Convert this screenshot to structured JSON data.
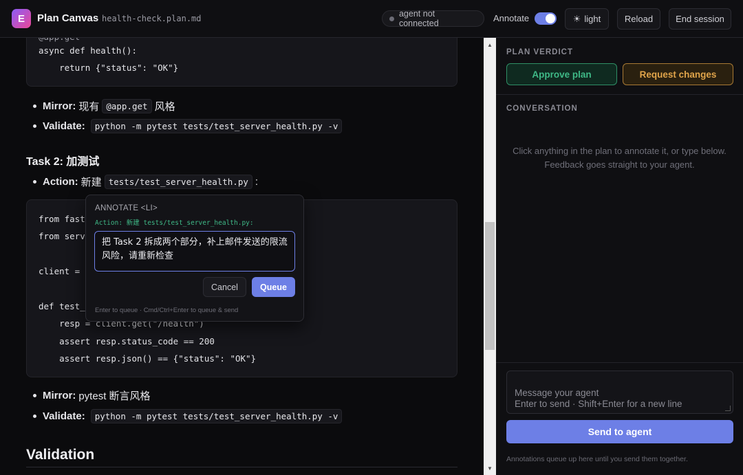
{
  "header": {
    "logo_letter": "E",
    "app_title": "Plan Canvas",
    "file_name": "health-check.plan.md",
    "agent_status": "agent not connected",
    "annotate_label": "Annotate",
    "annotate_enabled": true,
    "theme_label": "light",
    "reload_label": "Reload",
    "end_session_label": "End session"
  },
  "content": {
    "code_top": [
      "async def health():",
      "    return {\"status\": \"OK\"}"
    ],
    "task1_mirror_label": "Mirror:",
    "task1_mirror_text_pre": "现有",
    "task1_mirror_code": "@app.get",
    "task1_mirror_text_post": "风格",
    "task1_validate_label": "Validate:",
    "task1_validate_code": "python -m pytest tests/test_server_health.py -v",
    "task2_heading": "Task 2: 加测试",
    "task2_action_label": "Action:",
    "task2_action_text": "新建",
    "task2_action_code": "tests/test_server_health.py",
    "task2_action_suffix": ":",
    "code_task2": {
      "line1": "from fast",
      "line2": "from serv",
      "line3": "client =",
      "line4": "def test_",
      "line5": "    resp = client.get(\"/health\")",
      "line6": "    assert resp.status_code == 200",
      "line7": "    assert resp.json() == {\"status\": \"OK\"}"
    },
    "task2_mirror_label": "Mirror:",
    "task2_mirror_text": "pytest 断言风格",
    "task2_validate_label": "Validate:",
    "task2_validate_code": "python -m pytest tests/test_server_health.py -v",
    "validation_heading": "Validation"
  },
  "annotation": {
    "title": "ANNOTATE <LI>",
    "target": "Action: 新建 tests/test_server_health.py:",
    "text": "把 Task 2 拆成两个部分，补上邮件发送的限流风险，请重新检查",
    "cancel_label": "Cancel",
    "queue_label": "Queue",
    "hint": "Enter to queue · Cmd/Ctrl+Enter to queue & send"
  },
  "panel": {
    "verdict_label": "PLAN VERDICT",
    "approve_label": "Approve plan",
    "request_label": "Request changes",
    "conversation_label": "CONVERSATION",
    "empty_line1": "Click anything in the plan to annotate it, or type below.",
    "empty_line2": "Feedback goes straight to your agent.",
    "message_placeholder": "Message your agent\nEnter to send · Shift+Enter for a new line",
    "send_label": "Send to agent",
    "footnote": "Annotations queue up here until you send them together."
  },
  "colors": {
    "accent": "#6d7fe6",
    "approve": "#3fb987",
    "request": "#e0a44a"
  }
}
